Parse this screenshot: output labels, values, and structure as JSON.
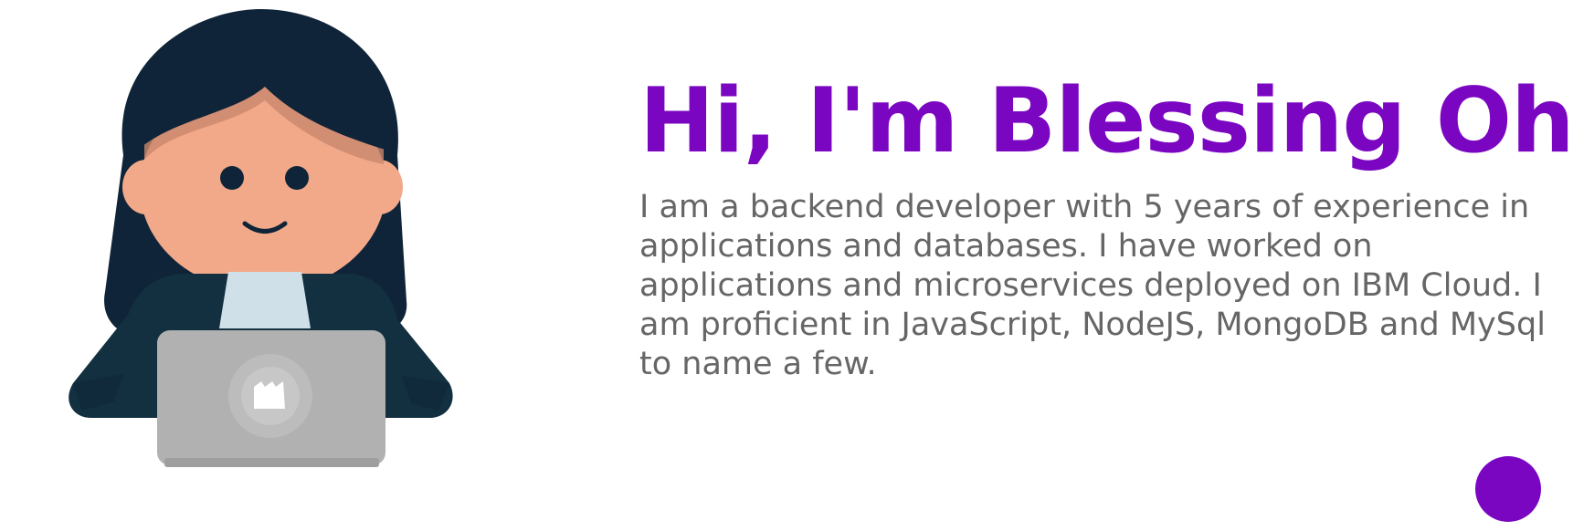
{
  "hero": {
    "greeting": "Hi, I'm Blessing Oh!",
    "greeting_icon": "fire-emoji-icon",
    "bio": "I am a backend developer with 5 years of experience in applications and databases. I have worked on applications and microservices deployed on IBM Cloud. I am proficient in JavaScript, NodeJS, MongoDB and MySql to name a few.",
    "illustration": "developer-avatar-with-laptop-illustration"
  },
  "colors": {
    "accent": "#7b06c2",
    "body_text": "#666666",
    "background": "#ffffff"
  },
  "floating_button": {
    "icon": "circle-button"
  }
}
